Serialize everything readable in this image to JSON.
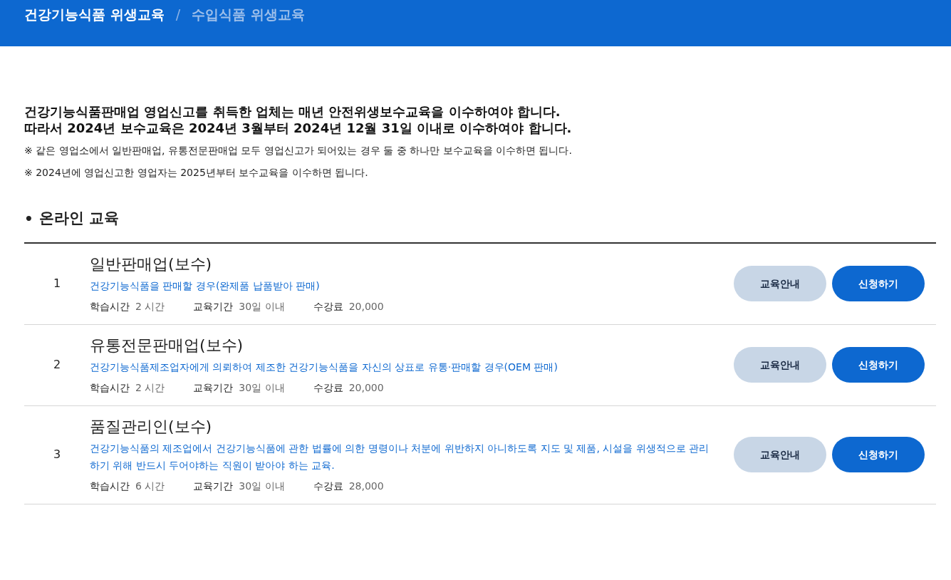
{
  "breadcrumb": [
    {
      "label": "건강기능식품 위생교육",
      "selected": true
    },
    {
      "label": "수입식품 위생교육",
      "selected": false
    }
  ],
  "separator": "/",
  "notice": {
    "headline": [
      "건강기능식품판매업 영업신고를 취득한 업체는 매년 안전위생보수교육을 이수하여야 합니다.",
      "따라서 2024년 보수교육은 2024년 3월부터 2024년 12월 31일 이내로 이수하여야 합니다."
    ],
    "notes": [
      "※ 같은 영업소에서 일반판매업, 유통전문판매업 모두 영업신고가 되어있는 경우 둘 중 하나만 보수교육을 이수하면 됩니다.",
      "※ 2024년에 영업신고한 영업자는 2025년부터 보수교육을 이수하면 됩니다."
    ]
  },
  "section": {
    "bullet": "•",
    "title": "온라인 교육"
  },
  "courses": [
    {
      "number": "1",
      "title": "일반판매업(보수)",
      "description": "건강기능식품을 판매할 경우(완제품 납품받아 판매)",
      "facts": [
        {
          "label": "학습시간",
          "value": "2 시간"
        },
        {
          "label": "교육기간",
          "value": "30일 이내"
        },
        {
          "label": "수강료",
          "value": "20,000"
        }
      ],
      "buttons": [
        {
          "label": "교육안내",
          "kind": "secondary"
        },
        {
          "label": "신청하기",
          "kind": "primary"
        }
      ]
    },
    {
      "number": "2",
      "title": "유통전문판매업(보수)",
      "description": "건강기능식품제조업자에게 의뢰하여 제조한 건강기능식품을 자신의 상표로 유통·판매할 경우(OEM 판매)",
      "facts": [
        {
          "label": "학습시간",
          "value": "2 시간"
        },
        {
          "label": "교육기간",
          "value": "30일 이내"
        },
        {
          "label": "수강료",
          "value": "20,000"
        }
      ],
      "buttons": [
        {
          "label": "교육안내",
          "kind": "secondary"
        },
        {
          "label": "신청하기",
          "kind": "primary"
        }
      ]
    },
    {
      "number": "3",
      "title": "품질관리인(보수)",
      "description": "건강기능식품의 제조업에서 건강기능식품에 관한 법률에 의한 명령이나 처분에 위반하지 아니하도록 지도 및 제품, 시설을 위생적으로 관리하기 위해 반드시 두어야하는 직원이 받아야 하는 교육.",
      "facts": [
        {
          "label": "학습시간",
          "value": "6 시간"
        },
        {
          "label": "교육기간",
          "value": "30일 이내"
        },
        {
          "label": "수강료",
          "value": "28,000"
        }
      ],
      "buttons": [
        {
          "label": "교육안내",
          "kind": "secondary"
        },
        {
          "label": "신청하기",
          "kind": "primary"
        }
      ]
    }
  ]
}
